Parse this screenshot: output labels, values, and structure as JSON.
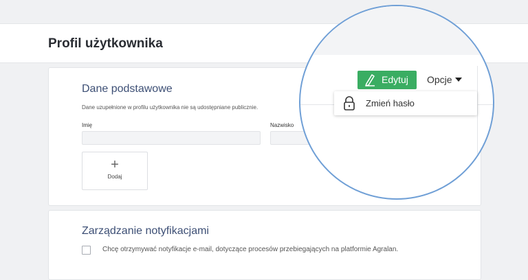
{
  "page": {
    "title": "Profil użytkownika"
  },
  "basic": {
    "title": "Dane podstawowe",
    "note": "Dane uzupełnione w profilu użytkownika nie są udostępniane publicznie.",
    "first_name_label": "Imię",
    "first_name_value": "",
    "last_name_label": "Nazwisko",
    "last_name_value": "",
    "add_label": "Dodaj"
  },
  "notifications": {
    "title": "Zarządzanie notyfikacjami",
    "email_checkbox_label": "Chcę otrzymywać notyfikacje e-mail, dotyczące procesów przebiegających na platformie Agralan.",
    "email_checked": false
  },
  "toolbar": {
    "edit_label": "Edytuj",
    "options_label": "Opcje",
    "options_menu": [
      {
        "label": "Zmień hasło",
        "icon": "lock-icon"
      }
    ]
  },
  "colors": {
    "accent_green": "#3aad62",
    "heading_blue": "#3d4f75",
    "magnifier_ring": "#6f9fd6"
  }
}
